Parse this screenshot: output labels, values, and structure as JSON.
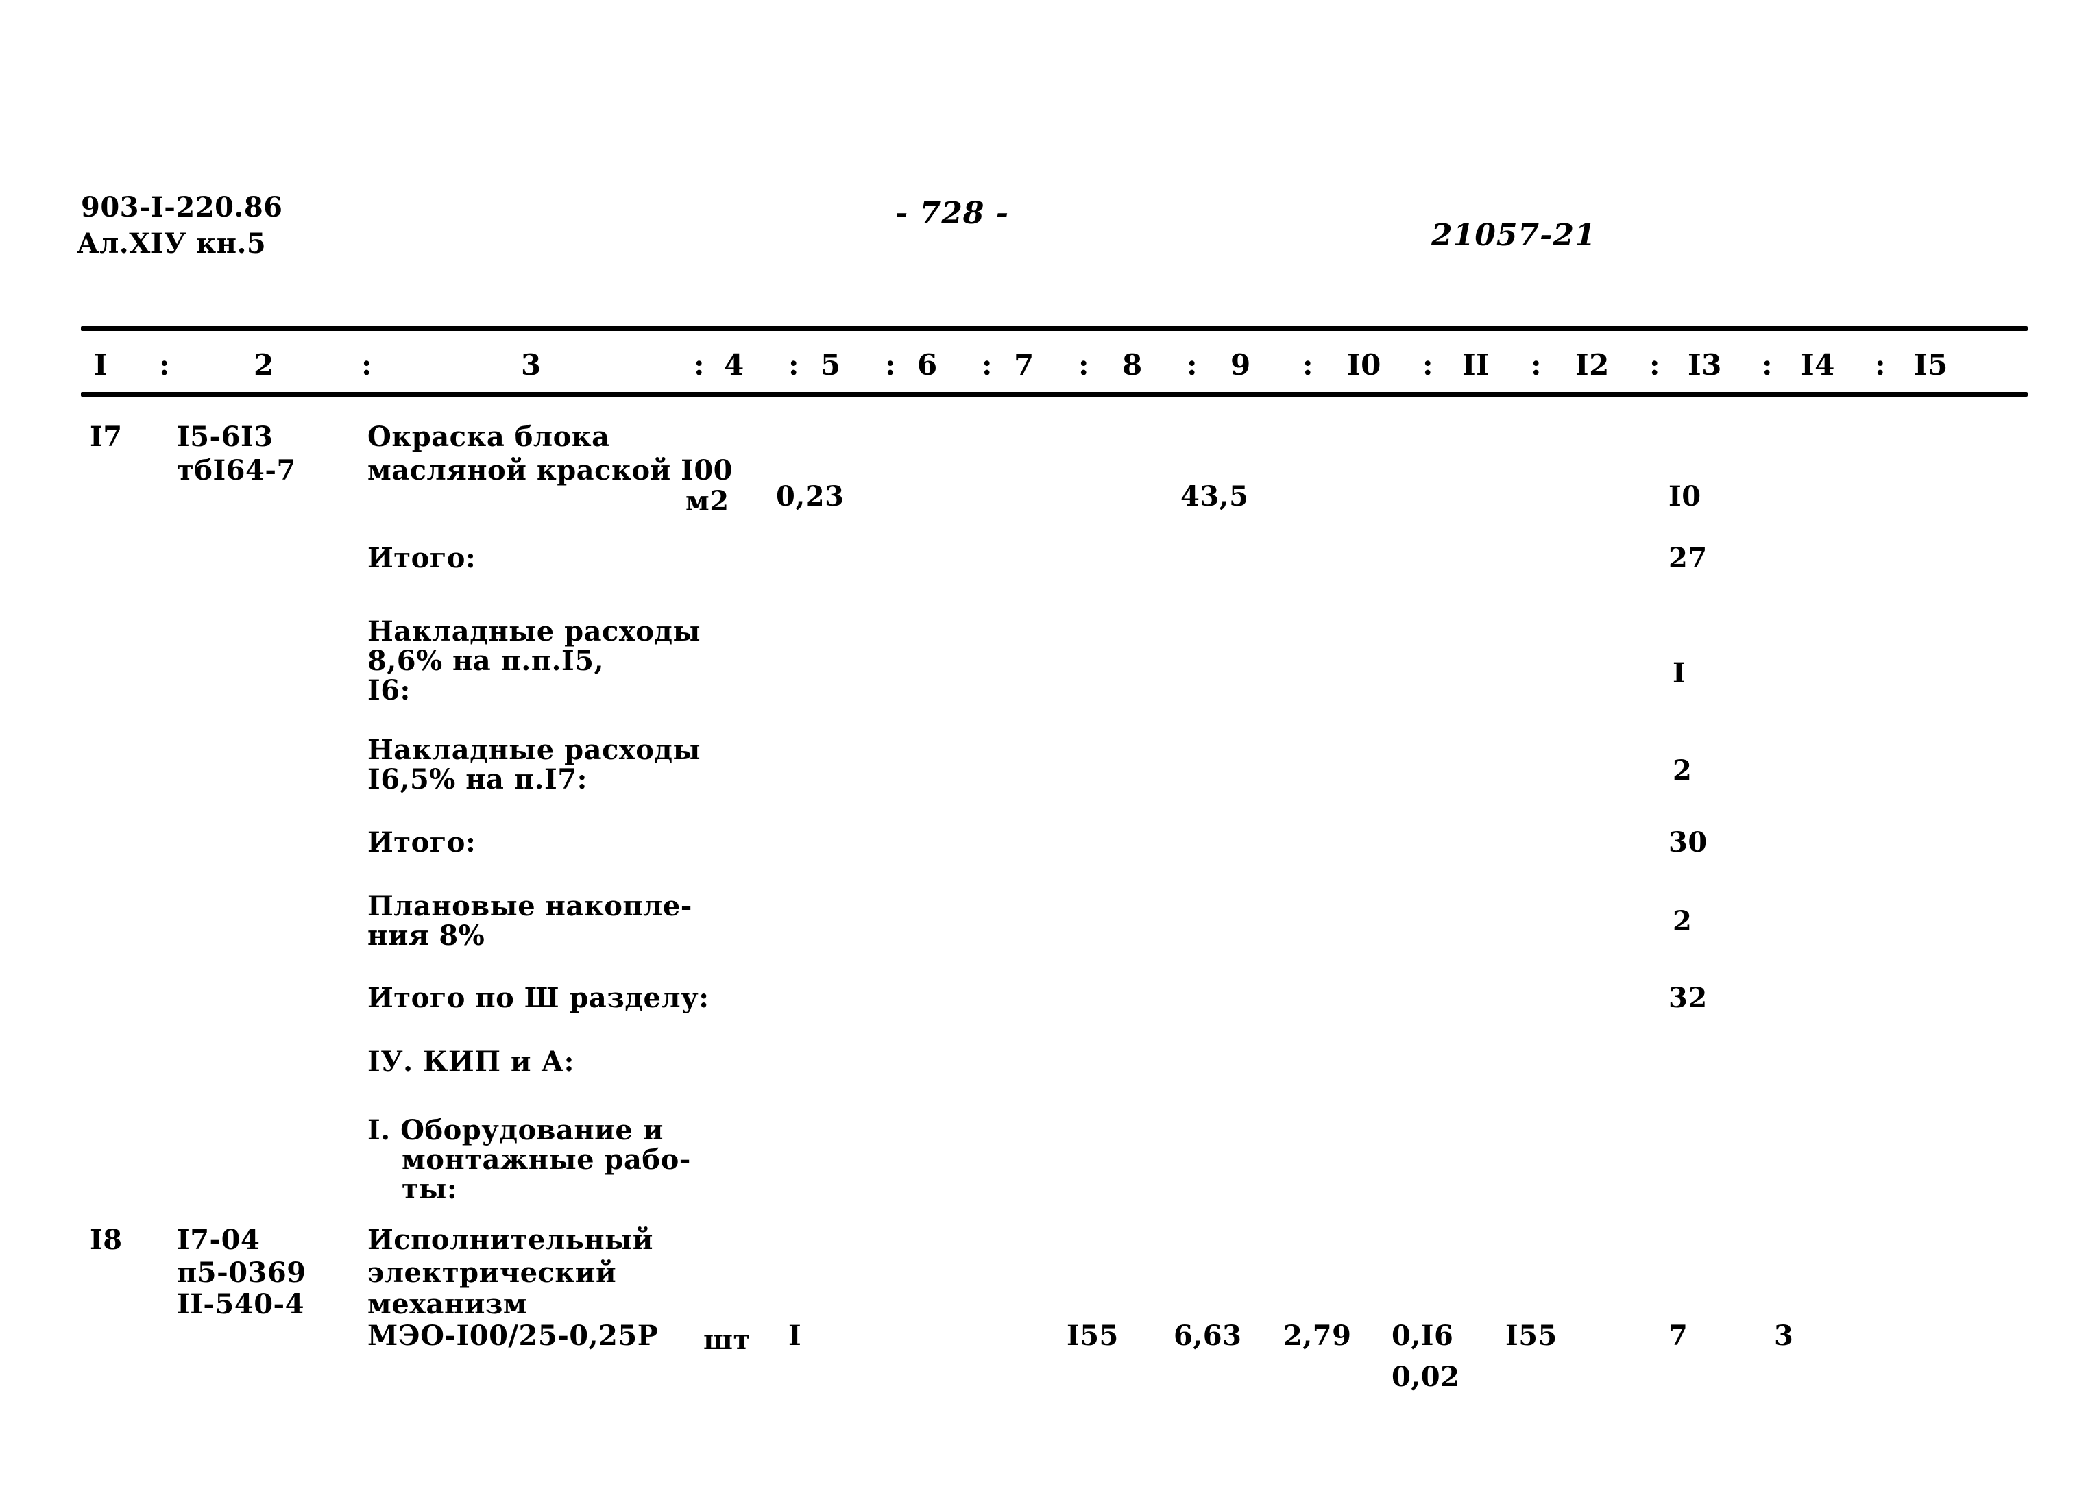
{
  "document": {
    "header": {
      "doc_code_line1": "903-I-220.86",
      "doc_code_line2": "Ал.ХIУ кн.5",
      "page_marker": "- 728 -",
      "sheet_code": "21057-21"
    },
    "table": {
      "column_headers": [
        "I",
        "2",
        "3",
        "4",
        "5",
        "6",
        "7",
        "8",
        "9",
        "I0",
        "II",
        "I2",
        "I3",
        "I4",
        "I5"
      ],
      "column_separator": ":",
      "rows": [
        {
          "kind": "item",
          "no": "I7",
          "codes": [
            "I5-6I3",
            "тбI64-7"
          ],
          "description": [
            "Окраска блока",
            "масляной краской I00"
          ],
          "unit": "м2",
          "qty": "0,23",
          "c5": "",
          "c6": "",
          "c7": "",
          "c8": "43,5",
          "c9": "",
          "c10": "",
          "c11": "",
          "c12": "",
          "c13": "I0",
          "c14": "",
          "c15": ""
        },
        {
          "kind": "total",
          "label": "Итого:",
          "c13": "27"
        },
        {
          "kind": "total",
          "label": "Накладные расходы\n8,6% на п.п.I5,\nI6:",
          "label_lines": [
            "Накладные расходы",
            "8,6% на п.п.I5,",
            "I6:"
          ],
          "c13": "I"
        },
        {
          "kind": "total",
          "label_lines": [
            "Накладные расходы",
            "I6,5% на п.I7:"
          ],
          "c13": "2"
        },
        {
          "kind": "total",
          "label_lines": [
            "Итого:"
          ],
          "c13": "30"
        },
        {
          "kind": "total",
          "label_lines": [
            "Плановые накопле-",
            "ния 8%"
          ],
          "c13": "2"
        },
        {
          "kind": "total",
          "label_lines": [
            "Итого по Ш разделу:"
          ],
          "c13": "32"
        },
        {
          "kind": "section",
          "label_lines": [
            "IУ. КИП и А:"
          ]
        },
        {
          "kind": "section",
          "label_lines": [
            "I. Оборудование и",
            "монтажные рабо-",
            "ты:"
          ]
        },
        {
          "kind": "item",
          "no": "I8",
          "codes": [
            "I7-04",
            "п5-0369",
            "II-540-4"
          ],
          "description": [
            "Исполнительный",
            "электрический",
            "механизм",
            "МЭО-I00/25-0,25Р"
          ],
          "unit": "шт",
          "qty": "I",
          "c5": "",
          "c6": "",
          "c7": "I55",
          "c8": "6,63",
          "c9": "2,79",
          "c10": "0,I6",
          "c10b": "0,02",
          "c11": "I55",
          "c12": "",
          "c13": "7",
          "c14": "3",
          "c15": ""
        }
      ]
    }
  }
}
